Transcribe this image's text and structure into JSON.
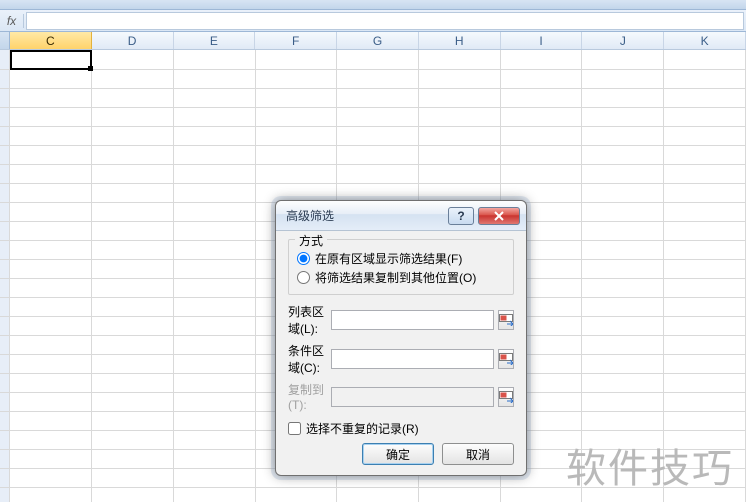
{
  "formula_bar": {
    "fx": "fx",
    "value": ""
  },
  "columns": [
    "C",
    "D",
    "E",
    "F",
    "G",
    "H",
    "I",
    "J",
    "K"
  ],
  "active_column_index": 0,
  "watermark": "软件技巧",
  "dialog": {
    "title": "高级筛选",
    "help_symbol": "?",
    "group_legend": "方式",
    "radio_in_place": "在原有区域显示筛选结果(F)",
    "radio_copy_to": "将筛选结果复制到其他位置(O)",
    "field_list_range": "列表区域(L):",
    "field_criteria_range": "条件区域(C):",
    "field_copy_to": "复制到(T):",
    "list_range_value": "",
    "criteria_range_value": "",
    "copy_to_value": "",
    "checkbox_unique": "选择不重复的记录(R)",
    "btn_ok": "确定",
    "btn_cancel": "取消"
  }
}
